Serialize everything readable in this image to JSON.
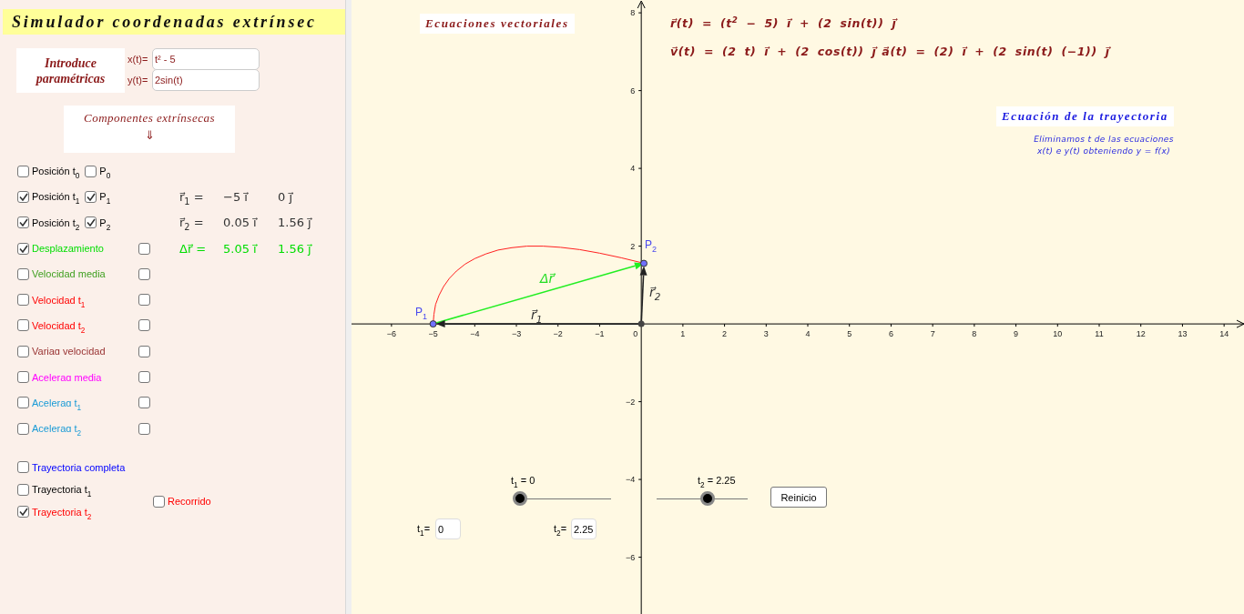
{
  "title": "Simulador coordenadas extrínsec",
  "parametric": {
    "label": "Introduce paramétricas",
    "fields": [
      {
        "label": "x(t)=",
        "value": "t² - 5"
      },
      {
        "label": "y(t)=",
        "value": "2sin(t)"
      }
    ]
  },
  "components": {
    "title": "Componentes extrínsecas",
    "arrow": "⇓"
  },
  "options": [
    {
      "label": "Posición t$_{0}$",
      "color": "#000000",
      "checked": false,
      "extra": {
        "label": "P$_{0}$",
        "checked": false
      }
    },
    {
      "label": "Posición t$_{1}$",
      "color": "#000000",
      "checked": true,
      "extra": {
        "label": "P$_{1}$",
        "checked": true
      },
      "equation": {
        "lhs": "r⃗$_{1}$ =",
        "i": "−5 i⃗",
        "j": "0 j⃗"
      }
    },
    {
      "label": "Posición t$_{2}$",
      "color": "#000000",
      "checked": true,
      "extra": {
        "label": "P$_{2}$",
        "checked": true
      },
      "equation": {
        "lhs": "r⃗$_{2}$ =",
        "i": "0.05 i⃗",
        "j": "1.56 j⃗"
      }
    },
    {
      "label": "Desplazamiento",
      "color": "#00dd00",
      "checked": true,
      "extra": {
        "checked": false
      },
      "equation": {
        "lhs": "Δr⃗ =",
        "i": "5.05 i⃗",
        "j": "1.56 j⃗"
      }
    },
    {
      "label": "Velocidad media",
      "color": "#3f9f1f",
      "checked": false,
      "extra": {
        "checked": false
      }
    },
    {
      "label": "Velocidad t$_{1}$",
      "color": "#ff0000",
      "checked": false,
      "extra": {
        "checked": false
      }
    },
    {
      "label": "Velocidad t$_{2}$",
      "color": "#ff0000",
      "checked": false,
      "extra": {
        "checked": false
      }
    },
    {
      "label": "Variaɑ velocidad",
      "color": "#993333",
      "checked": false,
      "extra": {
        "checked": false
      }
    },
    {
      "label": "Aceleraɑ media",
      "color": "#ff00ff",
      "checked": false,
      "extra": {
        "checked": false
      }
    },
    {
      "label": "Aceleraɑ t$_{1}$",
      "color": "#1a9bd6",
      "checked": false,
      "extra": {
        "checked": false
      }
    },
    {
      "label": "Aceleraɑ t$_{2}$",
      "color": "#1a9bd6",
      "checked": false,
      "extra": {
        "checked": false
      }
    }
  ],
  "trajectory_options": [
    {
      "label": "Trayectoria completa",
      "color": "#0000ff",
      "checked": false
    },
    {
      "label": "Trayectoria t$_{1}$",
      "color": "#000000",
      "checked": false
    },
    {
      "label": "Trayectoria t$_{2}$",
      "color": "#ff0000",
      "checked": true
    }
  ],
  "recorrido": {
    "label": "Recorrido",
    "color": "#ff0000",
    "checked": false
  },
  "graph": {
    "equations_title": "Ecuaciones vectoriales",
    "equations": [
      "r⃗(t) = (t$^{2}$ − 5) i⃗ + (2 sin(t)) j⃗",
      "v⃗(t) = (2 t) i⃗ + (2 cos(t)) j⃗",
      "a⃗(t) = (2) i⃗ + (2 sin(t) (−1)) j⃗"
    ],
    "trajectory_title": "Ecuación de la trayectoria",
    "trajectory_note": [
      "Eliminamos t de las ecuaciones",
      "x(t) e y(t) obteniendo y = f(x)"
    ],
    "origin_label": "0",
    "chart_data": {
      "type": "line",
      "x": [
        -5,
        -4.98,
        -4.94,
        -4.86,
        -4.75,
        -4.61,
        -4.44,
        -4.23,
        -4,
        -3.73,
        -3.44,
        -3.11,
        -2.75,
        -2.36,
        -1.94,
        -1.48,
        -1,
        -0.48,
        0.06
      ],
      "series": [
        {
          "color": "#ff2020",
          "values": [
            0,
            0.25,
            0.5,
            0.73,
            0.96,
            1.17,
            1.36,
            1.54,
            1.68,
            1.8,
            1.9,
            1.96,
            2,
            2,
            1.97,
            1.91,
            1.82,
            1.7,
            1.56
          ]
        }
      ],
      "xlim": [
        -6.96,
        14.5
      ],
      "ylim": [
        -7.46,
        8.33
      ],
      "xticks": [
        {
          "value": -6,
          "label": "−6"
        },
        {
          "value": -5,
          "label": "−5"
        },
        {
          "value": -4,
          "label": "−4"
        },
        {
          "value": -3,
          "label": "−3"
        },
        {
          "value": -2,
          "label": "−2"
        },
        {
          "value": -1,
          "label": "−1"
        },
        1,
        2,
        3,
        4,
        5,
        6,
        7,
        8,
        9,
        10,
        11,
        12,
        13,
        14
      ],
      "yticks": [
        8,
        6,
        4,
        2,
        {
          "value": -2,
          "label": "−2"
        },
        {
          "value": -4,
          "label": "−4"
        },
        {
          "value": -6,
          "label": "−6"
        }
      ]
    },
    "points": [
      "P$_{1}$",
      "P$_{2}$"
    ],
    "vector_labels": [
      "Δr⃗",
      "r⃗$_{1}$",
      "r⃗$_{2}$"
    ],
    "sliders": [
      {
        "label": "t$_{1}$ = 0",
        "level": 0
      },
      {
        "label": "t$_{2}$ = 2.25",
        "level": 0.56
      }
    ],
    "button": "Reinicio",
    "inputs": [
      {
        "label": "t$_{1}$=",
        "value": "0"
      },
      {
        "label": "t$_{2}$=",
        "value": "2.25"
      }
    ]
  }
}
